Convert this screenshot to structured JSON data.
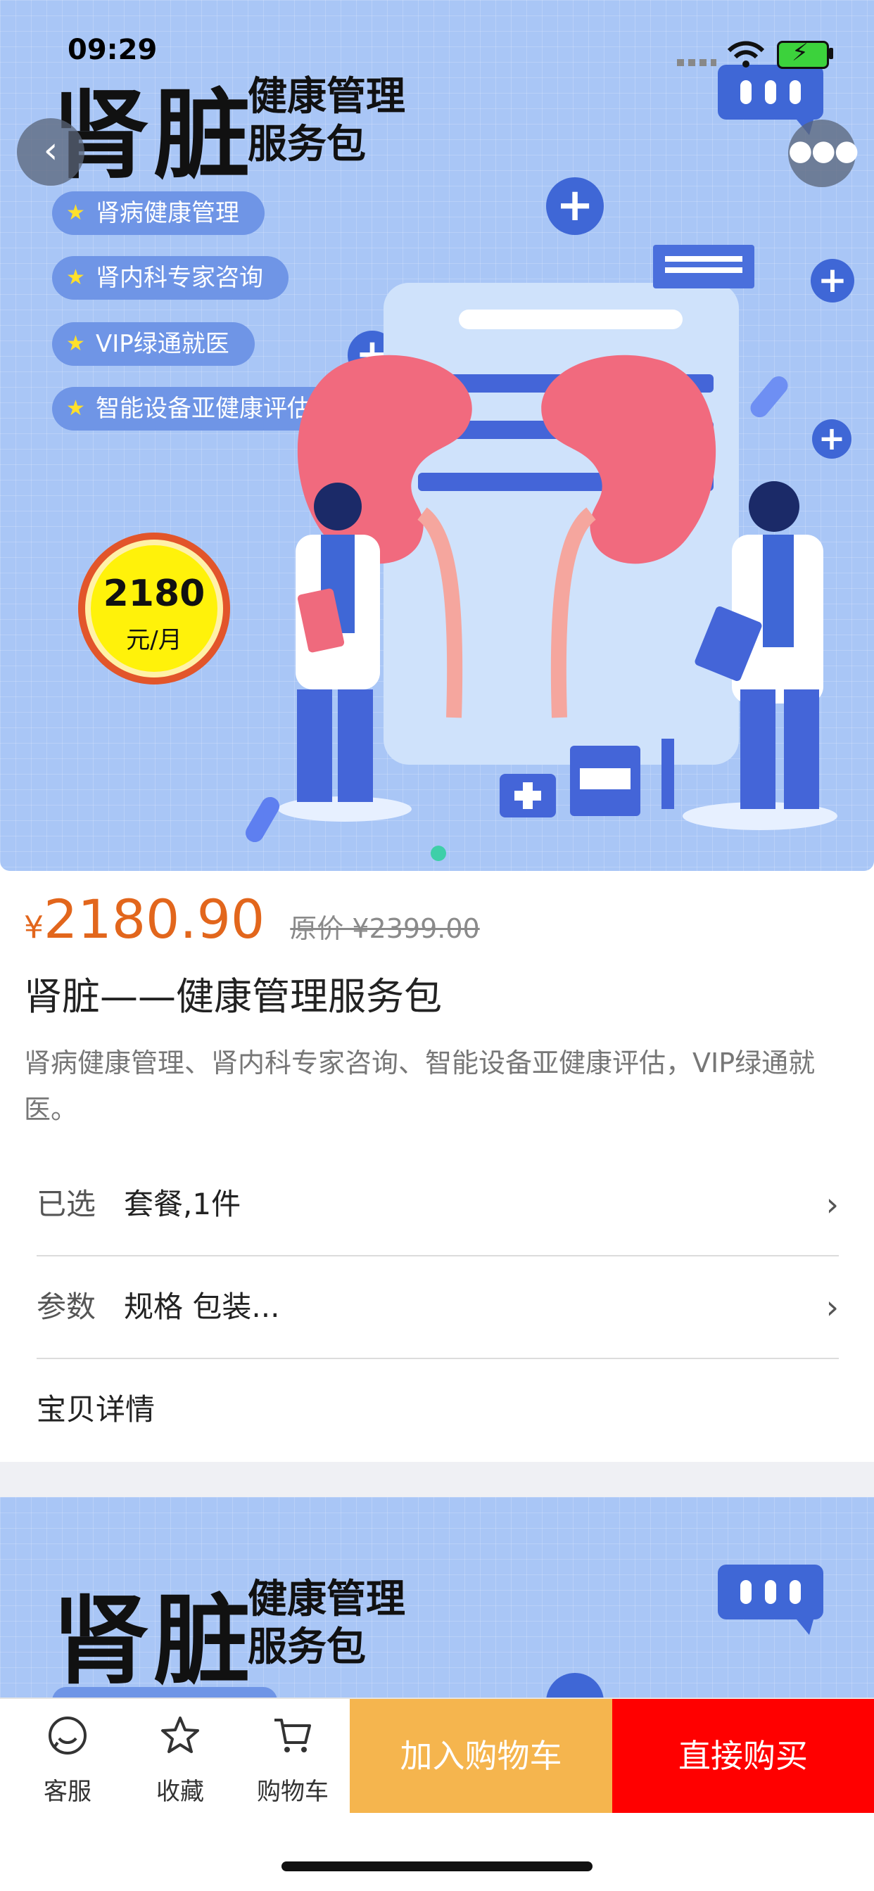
{
  "status_bar": {
    "time": "09:29"
  },
  "banner": {
    "title_main": "肾脏",
    "title_sub_1": "健康管理",
    "title_sub_2": "服务包",
    "tags": [
      "肾病健康管理",
      "肾内科专家咨询",
      "VIP绿通就医",
      "智能设备亚健康评估"
    ],
    "badge_price": "2180",
    "badge_unit": "元/月"
  },
  "nav": {
    "back_icon": "chevron-left-icon",
    "more_icon": "more-icon"
  },
  "product": {
    "currency": "¥",
    "price": "2180.90",
    "original_price": "原价 ¥2399.00",
    "title": "肾脏——健康管理服务包",
    "description": "肾病健康管理、肾内科专家咨询、智能设备亚健康评估，VIP绿通就医。"
  },
  "options": [
    {
      "key": "已选",
      "value": "套餐,1件"
    },
    {
      "key": "参数",
      "value": "规格 包装..."
    }
  ],
  "details_label": "宝贝详情",
  "tabbar": {
    "service": "客服",
    "favorite": "收藏",
    "cart": "购物车",
    "add_to_cart": "加入购物车",
    "buy_now": "直接购买"
  },
  "colors": {
    "price": "#e2661c",
    "cart_button": "#f5b54e",
    "buy_button": "#ff0000",
    "banner_bg": "#a9c6f6"
  }
}
